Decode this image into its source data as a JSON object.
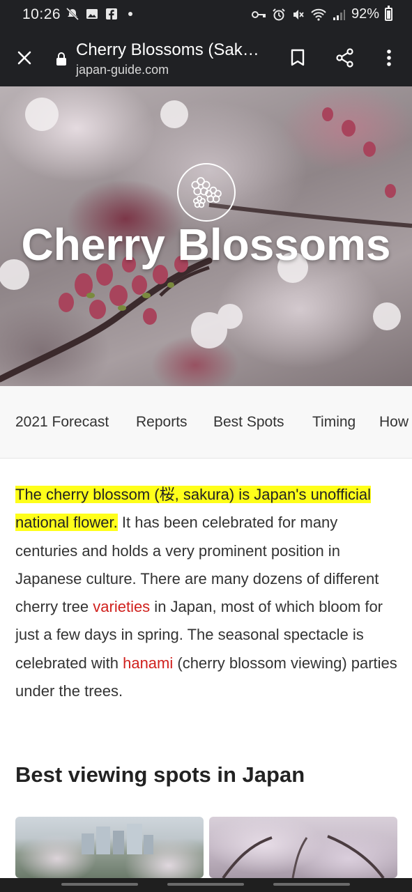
{
  "status_bar": {
    "time": "10:26",
    "battery_text": "92%",
    "left_icons": [
      "muted-notifications-icon",
      "image-icon",
      "facebook-icon",
      "dot-icon"
    ],
    "right_icons": [
      "vpn-key-icon",
      "alarm-icon",
      "vibrate-mute-icon",
      "wifi-icon",
      "signal-icon",
      "battery-icon"
    ]
  },
  "browser": {
    "title": "Cherry Blossoms (Sak…",
    "url": "japan-guide.com",
    "actions": [
      "close-icon",
      "bookmark-icon",
      "share-icon",
      "more-icon"
    ]
  },
  "hero": {
    "title": "Cherry Blossoms",
    "emblem_icon": "sakura-flower-icon"
  },
  "section_nav": {
    "items": [
      "2021 Forecast",
      "Reports",
      "Best Spots",
      "Timing",
      "How"
    ]
  },
  "article": {
    "highlight": "The cherry blossom (桜, sakura) is Japan's unofficial national flower.",
    "text_1": " It has been celebrated for many centuries and holds a very prominent position in Japanese culture. There are many dozens of different cherry tree ",
    "link_varieties": "varieties",
    "text_2": " in Japan, most of which bloom for just a few days in spring. The seasonal spectacle is celebrated with ",
    "link_hanami": "hanami",
    "text_3": " (cherry blossom viewing) parties under the trees."
  },
  "best_spots": {
    "heading": "Best viewing spots in Japan"
  },
  "colors": {
    "status_bar_bg": "#202124",
    "highlight": "#ffff1a",
    "link": "#d0201d",
    "text": "#333333"
  }
}
